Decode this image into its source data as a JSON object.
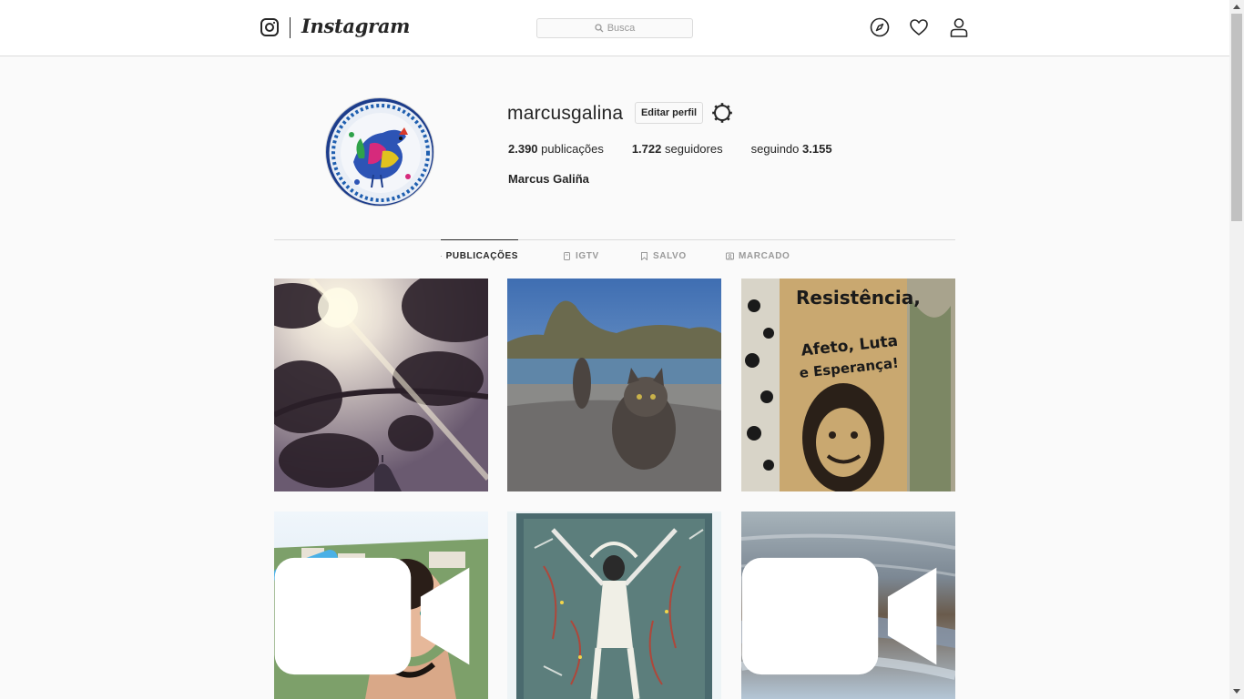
{
  "app": {
    "name": "Instagram"
  },
  "search": {
    "placeholder": "Busca"
  },
  "nav_icons": [
    "explore-icon",
    "heart-icon",
    "profile-icon"
  ],
  "profile": {
    "username": "marcusgalina",
    "edit_button": "Editar perfil",
    "posts_count": "2.390",
    "posts_label": "publicações",
    "followers_count": "1.722",
    "followers_label": "seguidores",
    "following_label": "seguindo",
    "following_count": "3.155",
    "full_name": "Marcus Galiña"
  },
  "tabs": [
    {
      "label": "PUBLICAÇÕES",
      "icon": "grid-icon",
      "active": true
    },
    {
      "label": "IGTV",
      "icon": "igtv-icon",
      "active": false
    },
    {
      "label": "SALVO",
      "icon": "bookmark-icon",
      "active": false
    },
    {
      "label": "MARCADO",
      "icon": "tag-icon",
      "active": false
    }
  ],
  "posts": [
    {
      "kind": "photo"
    },
    {
      "kind": "photo"
    },
    {
      "kind": "photo",
      "poster_text": [
        "Resistência,",
        "Afeto, Luta",
        "e Esperança!"
      ]
    },
    {
      "kind": "video"
    },
    {
      "kind": "photo"
    },
    {
      "kind": "video"
    }
  ],
  "colors": {
    "accent": "#262626",
    "border": "#dbdbdb",
    "background": "#fafafa"
  }
}
